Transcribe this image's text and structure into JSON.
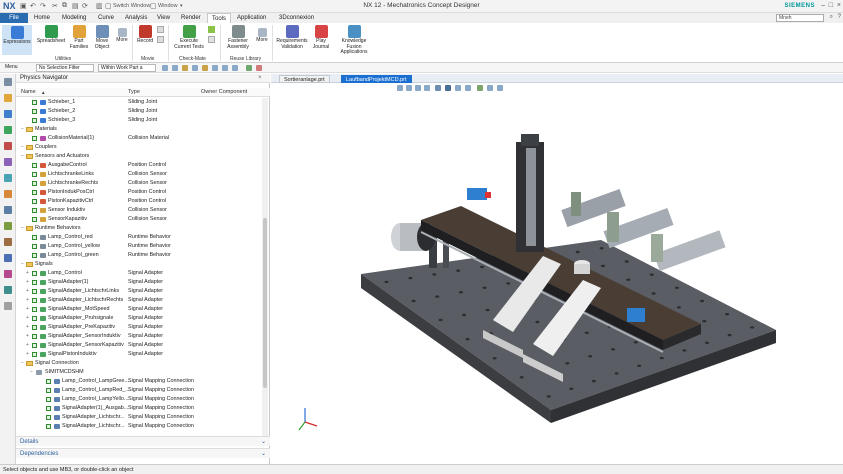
{
  "app": {
    "logo": "NX",
    "title": "NX 12 - Mechatronics Concept Designer",
    "brand": "SIEMENS",
    "quick_access": [
      "Switch Window",
      "Window"
    ]
  },
  "menu_tabs": [
    "File",
    "Home",
    "Modeling",
    "Curve",
    "Analysis",
    "View",
    "Render",
    "Tools",
    "Application",
    "3Dconnexion"
  ],
  "active_tab": "Tools",
  "search": {
    "value": "Mneh"
  },
  "ribbon": {
    "buttons": [
      "Expressions",
      "Spreadsheet",
      "Part Families",
      "Move Object",
      "More",
      "Record",
      "Execute Current Tests",
      "Fastener Assembly",
      "More",
      "Requirements Validation",
      "Play Journal",
      "Knowledge Fusion Applications"
    ],
    "groups": [
      "Utilities",
      "Movie",
      "Check-Mate",
      "Reuse Library"
    ]
  },
  "toolbar": {
    "menu_label": "Menu",
    "filter": "No Selection Filter",
    "scope": "Within Work Part a"
  },
  "navigator": {
    "title": "Physics Navigator",
    "columns": [
      "Name",
      "Type",
      "Owner Component"
    ],
    "rows": [
      {
        "name": "Schieber_1",
        "type": "Sliding Joint"
      },
      {
        "name": "Schieber_2",
        "type": "Sliding Joint"
      },
      {
        "name": "Schieber_3",
        "type": "Sliding Joint"
      },
      {
        "name": "Materials",
        "type": ""
      },
      {
        "name": "CollisionMaterial(1)",
        "type": "Collision Material"
      },
      {
        "name": "Couplers",
        "type": ""
      },
      {
        "name": "Sensors and Actuators",
        "type": ""
      },
      {
        "name": "AusgabeControl",
        "type": "Position Control"
      },
      {
        "name": "LichtschrankeLinks",
        "type": "Collision Sensor"
      },
      {
        "name": "LichtschrankeRechts",
        "type": "Collision Sensor"
      },
      {
        "name": "PistonIndukPosCtrl",
        "type": "Position Control"
      },
      {
        "name": "PistonKapazitivCtrl",
        "type": "Position Control"
      },
      {
        "name": "Sensor Induktiv",
        "type": "Collision Sensor"
      },
      {
        "name": "SensorKapazitiv",
        "type": "Collision Sensor"
      },
      {
        "name": "Runtime Behaviors",
        "type": ""
      },
      {
        "name": "Lamp_Control_red",
        "type": "Runtime Behavior"
      },
      {
        "name": "Lamp_Control_yellow",
        "type": "Runtime Behavior"
      },
      {
        "name": "Lamp_Control_green",
        "type": "Runtime Behavior"
      },
      {
        "name": "Signals",
        "type": ""
      },
      {
        "name": "Lamp_Control",
        "type": "Signal Adapter"
      },
      {
        "name": "SignalAdapter(1)",
        "type": "Signal Adapter"
      },
      {
        "name": "SignalAdapter_LichtschrLinks",
        "type": "Signal Adapter"
      },
      {
        "name": "SignalAdapter_LichtschrRechts",
        "type": "Signal Adapter"
      },
      {
        "name": "SignalAdapter_MotSpeed",
        "type": "Signal Adapter"
      },
      {
        "name": "SignalAdapter_Pruhsignale",
        "type": "Signal Adapter"
      },
      {
        "name": "SignalAdapter_PreKapazitiv",
        "type": "Signal Adapter"
      },
      {
        "name": "SignalAdapter_SensorInduktiv",
        "type": "Signal Adapter"
      },
      {
        "name": "SignalAdapter_SensorKapazitiv",
        "type": "Signal Adapter"
      },
      {
        "name": "SignalPistonInduktiv",
        "type": "Signal Adapter"
      },
      {
        "name": "Signal Connection",
        "type": ""
      },
      {
        "name": "SIMITMCDSHM",
        "type": ""
      },
      {
        "name": "Lamp_Control_LampGree...",
        "type": "Signal Mapping Connection"
      },
      {
        "name": "Lamp_Control_LampRed_...",
        "type": "Signal Mapping Connection"
      },
      {
        "name": "Lamp_Control_LampYello...",
        "type": "Signal Mapping Connection"
      },
      {
        "name": "SignalAdapter(1)_Ausgab...",
        "type": "Signal Mapping Connection"
      },
      {
        "name": "SignalAdapter_Lichtschr...",
        "type": "Signal Mapping Connection"
      },
      {
        "name": "SignalAdapter_Lichtschr...",
        "type": "Signal Mapping Connection"
      }
    ],
    "footer": [
      "Details",
      "Dependencies"
    ]
  },
  "graphics_tabs": [
    "Sortieranlage.prt",
    "LaufbandProjektMCD.prt"
  ],
  "active_graphics_tab": "LaufbandProjektMCD.prt",
  "status": "Select objects and use MB3, or double-click an object"
}
